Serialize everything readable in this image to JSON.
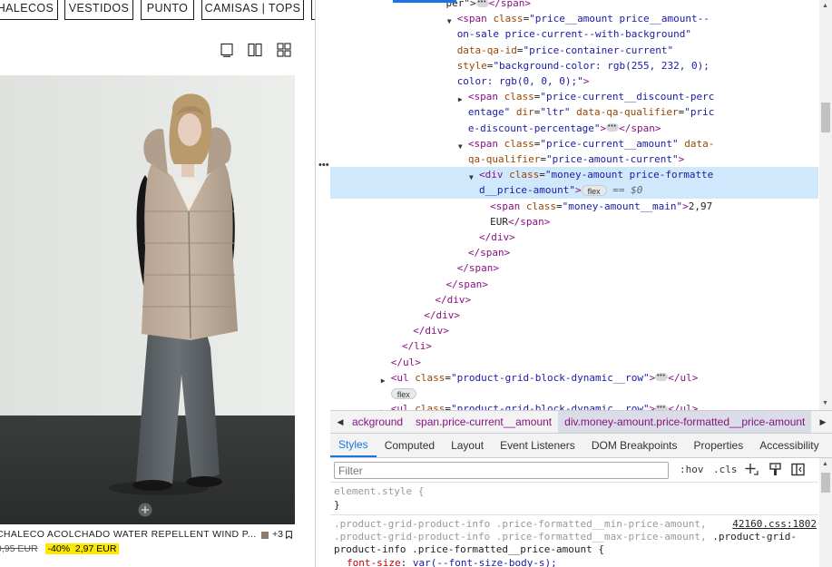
{
  "store": {
    "category_tabs": [
      "HALECOS",
      "VESTIDOS",
      "PUNTO",
      "CAMISAS | TOPS"
    ],
    "view_icons": [
      "single-column-view-icon",
      "two-column-view-icon",
      "grid-view-icon"
    ],
    "product": {
      "name": "CHALECO ACOLCHADO WATER REPELLENT WIND P...",
      "more_colors": "+3",
      "old_price": "9,95 EUR",
      "discount": "-40%",
      "current_price": "2,97 EUR",
      "sale_color": "#ffe800",
      "add_icon": "plus-circle-icon"
    }
  },
  "devtools": {
    "dom_lines": [
      {
        "indent": 17,
        "html": "<span class='tx'>per\"&gt;</span><span class='ellips'></span><span class='tg'>&lt;/span&gt;</span>",
        "arrow": ""
      },
      {
        "indent": 18,
        "html": "<span class='tg'>&lt;span</span> <span class='an'>class</span>=<span class='av'>\"price__amount price__amount--</span>",
        "arrow": "down"
      },
      {
        "indent": 18,
        "html": "<span class='av'>on-sale price-current--with-background\"</span>",
        "arrow": ""
      },
      {
        "indent": 18,
        "html": "<span class='an'>data-qa-id</span>=<span class='av'>\"price-container-current\"</span>",
        "arrow": ""
      },
      {
        "indent": 18,
        "html": "<span class='an'>style</span>=<span class='av'>\"background-color: rgb(255, 232, 0);</span>",
        "arrow": ""
      },
      {
        "indent": 18,
        "html": "<span class='av'>color: rgb(0, 0, 0);\"</span><span class='tg'>&gt;</span>",
        "arrow": ""
      },
      {
        "indent": 19,
        "html": "<span class='tg'>&lt;span</span> <span class='an'>class</span>=<span class='av'>\"price-current__discount-perc</span>",
        "arrow": "right"
      },
      {
        "indent": 19,
        "html": "<span class='av'>entage\"</span> <span class='an'>dir</span>=<span class='av'>\"ltr\"</span> <span class='an'>data-qa-qualifier</span>=<span class='av'>\"pric</span>",
        "arrow": ""
      },
      {
        "indent": 19,
        "html": "<span class='av'>e-discount-percentage\"</span><span class='tg'>&gt;</span><span class='ellips'></span><span class='tg'>&lt;/span&gt;</span>",
        "arrow": ""
      },
      {
        "indent": 19,
        "html": "<span class='tg'>&lt;span</span> <span class='an'>class</span>=<span class='av'>\"price-current__amount\"</span> <span class='an'>data-</span>",
        "arrow": "down"
      },
      {
        "indent": 19,
        "html": "<span class='an'>qa-qualifier</span>=<span class='av'>\"price-amount-current\"</span><span class='tg'>&gt;</span>",
        "arrow": ""
      },
      {
        "indent": 20,
        "html": "<span class='tg'>&lt;div</span> <span class='an'>class</span>=<span class='av'>\"money-amount price-formatte</span>",
        "arrow": "down",
        "selected": true
      },
      {
        "indent": 20,
        "html": "<span class='av'>d__price-amount\"</span><span class='tg'>&gt;</span><span class='badge'>flex</span> <span class='eq'>== $0</span>",
        "arrow": "",
        "selected": true
      },
      {
        "indent": 21,
        "html": "<span class='tg'>&lt;span</span> <span class='an'>class</span>=<span class='av'>\"money-amount__main\"</span><span class='tg'>&gt;</span><span class='tx'>2,97</span>",
        "arrow": ""
      },
      {
        "indent": 21,
        "html": "<span class='tx'>EUR</span><span class='tg'>&lt;/span&gt;</span>",
        "arrow": ""
      },
      {
        "indent": 20,
        "html": "<span class='tg'>&lt;/div&gt;</span>",
        "arrow": ""
      },
      {
        "indent": 19,
        "html": "<span class='tg'>&lt;/span&gt;</span>",
        "arrow": ""
      },
      {
        "indent": 18,
        "html": "<span class='tg'>&lt;/span&gt;</span>",
        "arrow": ""
      },
      {
        "indent": 17,
        "html": "<span class='tg'>&lt;/span&gt;</span>",
        "arrow": ""
      },
      {
        "indent": 16,
        "html": "<span class='tg'>&lt;/div&gt;</span>",
        "arrow": ""
      },
      {
        "indent": 15,
        "html": "<span class='tg'>&lt;/div&gt;</span>",
        "arrow": ""
      },
      {
        "indent": 14,
        "html": "<span class='tg'>&lt;/div&gt;</span>",
        "arrow": ""
      },
      {
        "indent": 13,
        "html": "<span class='tg'>&lt;/li&gt;</span>",
        "arrow": ""
      },
      {
        "indent": 12,
        "html": "<span class='tg'>&lt;/ul&gt;</span>",
        "arrow": ""
      },
      {
        "indent": 12,
        "html": "<span class='tg'>&lt;ul</span> <span class='an'>class</span>=<span class='av'>\"product-grid-block-dynamic__row\"</span><span class='tg'>&gt;</span><span class='ellips'></span><span class='tg'>&lt;/ul&gt;</span>",
        "arrow": "right"
      },
      {
        "indent": 12,
        "html": "<span class='badge'>flex</span>",
        "arrow": ""
      },
      {
        "indent": 12,
        "html": "<span class='tg'>&lt;ul</span> <span class='an'>class</span>=<span class='av'>\"product-grid-block-dynamic__row\"</span><span class='tg'>&gt;</span><span class='ellips'></span><span class='tg'>&lt;/ul&gt;</span>",
        "arrow": "right"
      }
    ],
    "breadcrumbs": [
      "ackground",
      "span.price-current__amount",
      "div.money-amount.price-formatted__price-amount"
    ],
    "tabs": [
      "Styles",
      "Computed",
      "Layout",
      "Event Listeners",
      "DOM Breakpoints",
      "Properties",
      "Accessibility"
    ],
    "active_tab": "Styles",
    "filter_placeholder": "Filter",
    "hov_label": ":hov",
    "cls_label": ".cls",
    "styles": {
      "element_style": "element.style {",
      "close_brace": "}",
      "selector_line1": ".product-grid-product-info .price-formatted__min-price-amount,",
      "selector_line2a": ".product-grid-product-info .price-formatted__max-price-amount,",
      "selector_line2b": " .product-grid-",
      "selector_line3": "product-info .price-formatted__price-amount {",
      "source_link": "42160.css:1802",
      "prop_name": "font-size",
      "prop_value": "var(--font-size-body-s);"
    }
  }
}
